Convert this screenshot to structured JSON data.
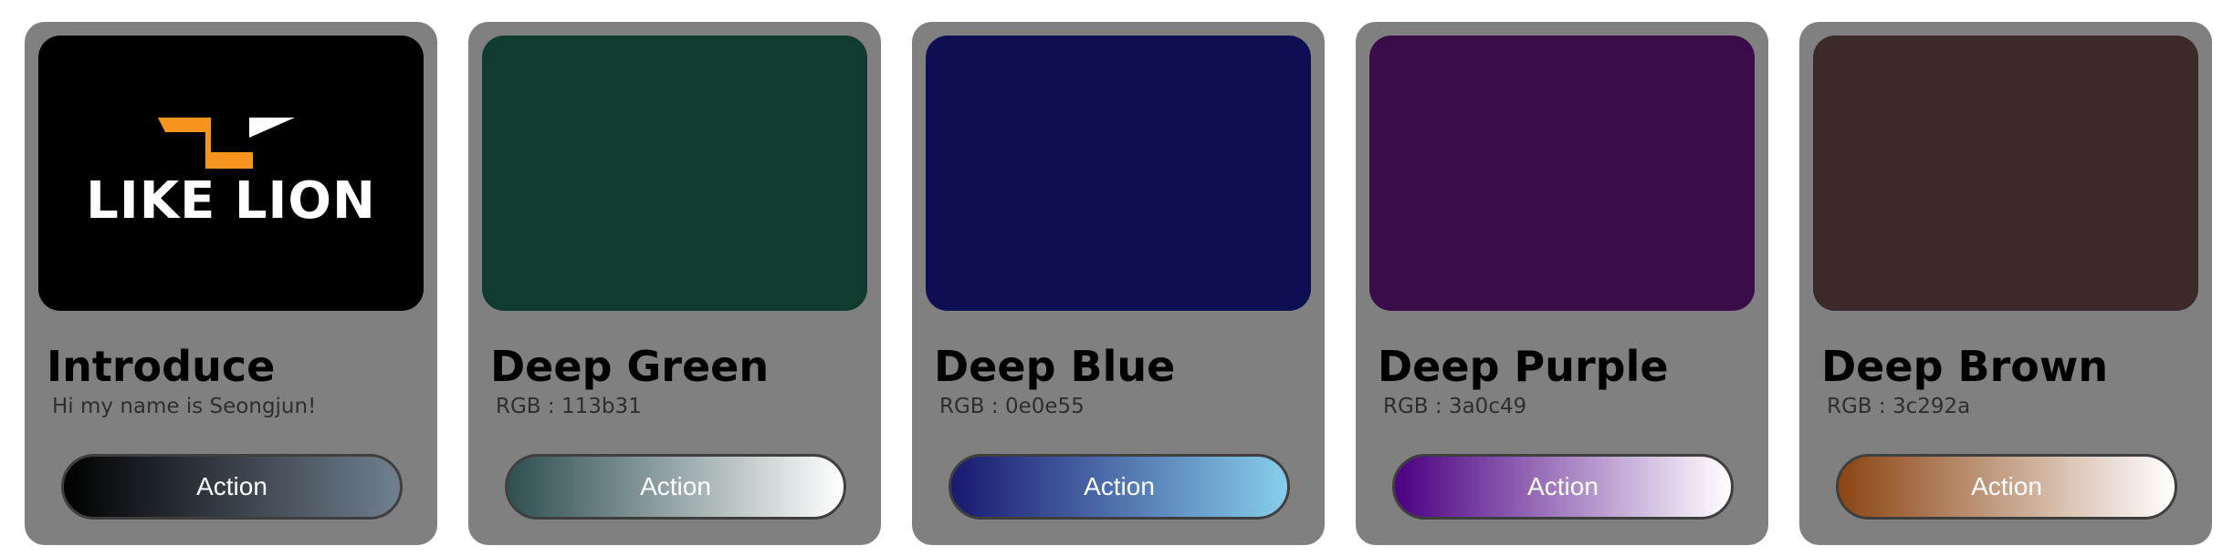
{
  "cards": [
    {
      "title": "Introduce",
      "subtitle": "Hi my name is Seongjun!",
      "button_label": "Action",
      "swatch_color": "#000000",
      "logo_text": "LIKE LION",
      "logo_accent_color": "#f7941d",
      "gradient": [
        "#000000",
        "#708090"
      ]
    },
    {
      "title": "Deep Green",
      "subtitle": "RGB : 113b31",
      "button_label": "Action",
      "swatch_color": "#113b31",
      "gradient": [
        "#2f4f4f",
        "#ffffff"
      ]
    },
    {
      "title": "Deep Blue",
      "subtitle": "RGB : 0e0e55",
      "button_label": "Action",
      "swatch_color": "#0e0e55",
      "gradient": [
        "#191970",
        "#87ceeb"
      ]
    },
    {
      "title": "Deep Purple",
      "subtitle": "RGB : 3a0c49",
      "button_label": "Action",
      "swatch_color": "#3a0c49",
      "gradient": [
        "#4b0082",
        "#ffffff"
      ]
    },
    {
      "title": "Deep Brown",
      "subtitle": "RGB : 3c292a",
      "button_label": "Action",
      "swatch_color": "#3c292a",
      "gradient": [
        "#8b4513",
        "#ffffff"
      ]
    }
  ]
}
